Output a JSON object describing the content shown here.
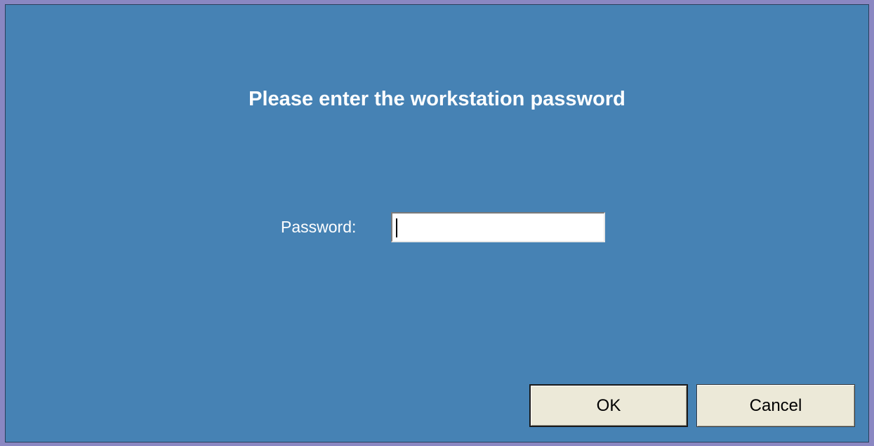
{
  "colors": {
    "frame": "#8a87c2",
    "dialog_background": "#4682b4",
    "text": "#ffffff",
    "button_face": "#ece9d8"
  },
  "dialog": {
    "title": "Please enter the workstation password",
    "password_label": "Password:",
    "password_value": "",
    "ok_label": "OK",
    "cancel_label": "Cancel"
  }
}
